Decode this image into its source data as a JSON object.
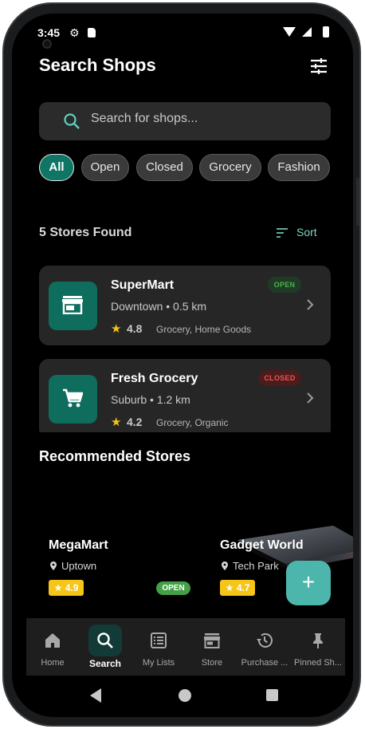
{
  "status": {
    "time": "3:45"
  },
  "header": {
    "title": "Search Shops"
  },
  "search": {
    "placeholder": "Search for shops..."
  },
  "chips": [
    "All",
    "Open",
    "Closed",
    "Grocery",
    "Fashion"
  ],
  "results": {
    "count_label": "5 Stores Found",
    "sort_label": "Sort"
  },
  "stores": [
    {
      "name": "SuperMart",
      "location": "Downtown • 0.5 km",
      "rating": "4.8",
      "categories": "Grocery, Home Goods",
      "status": "OPEN"
    },
    {
      "name": "Fresh Grocery",
      "location": "Suburb • 1.2 km",
      "rating": "4.2",
      "categories": "Grocery, Organic",
      "status": "CLOSED"
    }
  ],
  "recommended": {
    "title": "Recommended Stores",
    "items": [
      {
        "name": "MegaMart",
        "location": "Uptown",
        "rating": "★ 4.9",
        "status": "OPEN"
      },
      {
        "name": "Gadget World",
        "location": "Tech Park",
        "rating": "★ 4.7"
      }
    ]
  },
  "fab": {
    "label": "+"
  },
  "nav": [
    {
      "label": "Home",
      "icon": "home-icon"
    },
    {
      "label": "Search",
      "icon": "search-icon",
      "active": true
    },
    {
      "label": "My Lists",
      "icon": "list-icon"
    },
    {
      "label": "Store",
      "icon": "store-icon"
    },
    {
      "label": "Purchase ...",
      "icon": "history-icon"
    },
    {
      "label": "Pinned Sh...",
      "icon": "pin-icon"
    }
  ],
  "colors": {
    "accent": "#0f7564",
    "fab": "#4db6ac",
    "open_green": "#4caf50",
    "closed_red": "#ef5350",
    "rating_yellow": "#f5c518"
  }
}
